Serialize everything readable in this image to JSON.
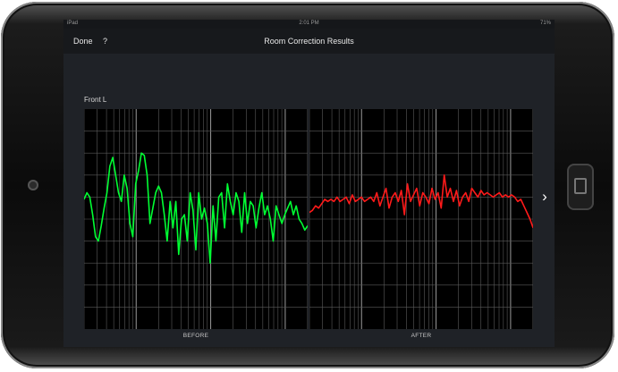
{
  "status_bar": {
    "carrier": "iPad",
    "time": "2:01 PM",
    "battery": "71%"
  },
  "nav": {
    "done_label": "Done",
    "help_label": "?",
    "title": "Room Correction Results"
  },
  "channel_label": "Front L",
  "next_icon": "chevron-right-icon",
  "colors": {
    "before_line": "#00ff33",
    "after_line": "#ff1a1a",
    "grid": "#5a5a5a",
    "plot_bg": "#000000",
    "screen_bg": "#1f2227"
  },
  "chart_data": [
    {
      "type": "line",
      "title": "",
      "xlabel": "BEFORE",
      "ylabel": "",
      "x_scale": "log",
      "grid": true,
      "ylim": [
        0,
        1
      ],
      "series": [
        {
          "values": [
            0.59,
            0.62,
            0.6,
            0.52,
            0.42,
            0.4,
            0.47,
            0.55,
            0.62,
            0.74,
            0.78,
            0.7,
            0.62,
            0.58,
            0.7,
            0.64,
            0.48,
            0.42,
            0.66,
            0.72,
            0.8,
            0.79,
            0.7,
            0.48,
            0.55,
            0.62,
            0.65,
            0.62,
            0.52,
            0.4,
            0.58,
            0.46,
            0.58,
            0.34,
            0.5,
            0.52,
            0.4,
            0.62,
            0.54,
            0.36,
            0.62,
            0.5,
            0.55,
            0.48,
            0.3,
            0.56,
            0.4,
            0.6,
            0.62,
            0.46,
            0.66,
            0.58,
            0.52,
            0.62,
            0.58,
            0.44,
            0.62,
            0.48,
            0.58,
            0.56,
            0.46,
            0.55,
            0.62,
            0.52,
            0.56,
            0.5,
            0.4,
            0.56,
            0.52,
            0.48,
            0.52,
            0.55,
            0.58,
            0.52,
            0.56,
            0.5,
            0.48,
            0.45,
            0.47
          ]
        }
      ]
    },
    {
      "type": "line",
      "title": "",
      "xlabel": "AFTER",
      "ylabel": "",
      "x_scale": "log",
      "grid": true,
      "ylim": [
        0,
        1
      ],
      "series": [
        {
          "values": [
            0.53,
            0.54,
            0.56,
            0.55,
            0.57,
            0.59,
            0.58,
            0.59,
            0.58,
            0.6,
            0.58,
            0.59,
            0.6,
            0.57,
            0.61,
            0.58,
            0.59,
            0.6,
            0.58,
            0.59,
            0.6,
            0.58,
            0.62,
            0.56,
            0.6,
            0.64,
            0.55,
            0.6,
            0.62,
            0.58,
            0.63,
            0.52,
            0.66,
            0.58,
            0.61,
            0.64,
            0.56,
            0.62,
            0.6,
            0.57,
            0.64,
            0.59,
            0.62,
            0.55,
            0.7,
            0.6,
            0.64,
            0.58,
            0.63,
            0.56,
            0.6,
            0.62,
            0.58,
            0.64,
            0.62,
            0.6,
            0.63,
            0.61,
            0.62,
            0.61,
            0.6,
            0.61,
            0.62,
            0.6,
            0.61,
            0.6,
            0.61,
            0.6,
            0.58,
            0.59,
            0.56,
            0.53,
            0.5,
            0.46
          ]
        }
      ]
    }
  ]
}
